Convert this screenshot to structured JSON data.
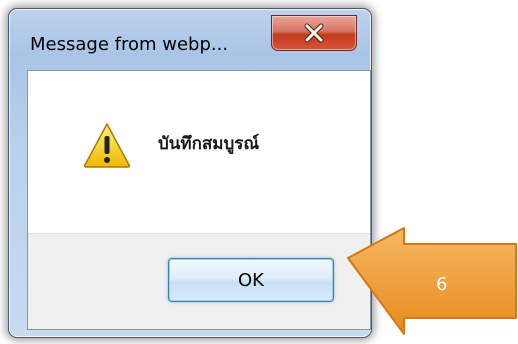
{
  "dialog": {
    "title": "Message from webp...",
    "close_icon": "close-x-icon",
    "message": "บันทึกสมบูรณ์",
    "message_icon": "warning-triangle-icon",
    "ok_label": "OK"
  },
  "callout": {
    "number": "6",
    "color": "#f0a040"
  },
  "colors": {
    "frame": "#b9d0eb",
    "close_button": "#c8462c",
    "button_border": "#3c7fb1",
    "footer": "#f0f0f0"
  }
}
